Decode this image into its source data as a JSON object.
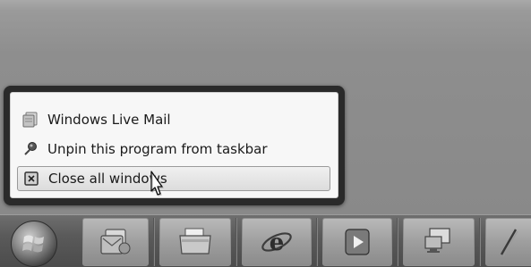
{
  "jumplist": {
    "items": [
      {
        "label": "Windows Live Mail",
        "icon": "windows-live-mail-icon"
      },
      {
        "label": "Unpin this program from taskbar",
        "icon": "unpin-icon"
      },
      {
        "label": "Close all windows",
        "icon": "close-window-icon",
        "hovered": true
      }
    ]
  },
  "taskbar": {
    "start_icon": "windows-start-orb-icon",
    "buttons": [
      {
        "icon": "windows-live-mail-icon"
      },
      {
        "icon": "file-explorer-icon"
      },
      {
        "icon": "internet-explorer-icon"
      },
      {
        "icon": "media-player-icon"
      },
      {
        "icon": "remote-desktop-icon"
      },
      {
        "icon": "pen-icon"
      }
    ]
  },
  "colors": {
    "desktop": "#8e8e8e",
    "taskbar": "#5a5a5a",
    "menu_background": "#f7f7f7",
    "menu_border": "#2a2a2a"
  }
}
